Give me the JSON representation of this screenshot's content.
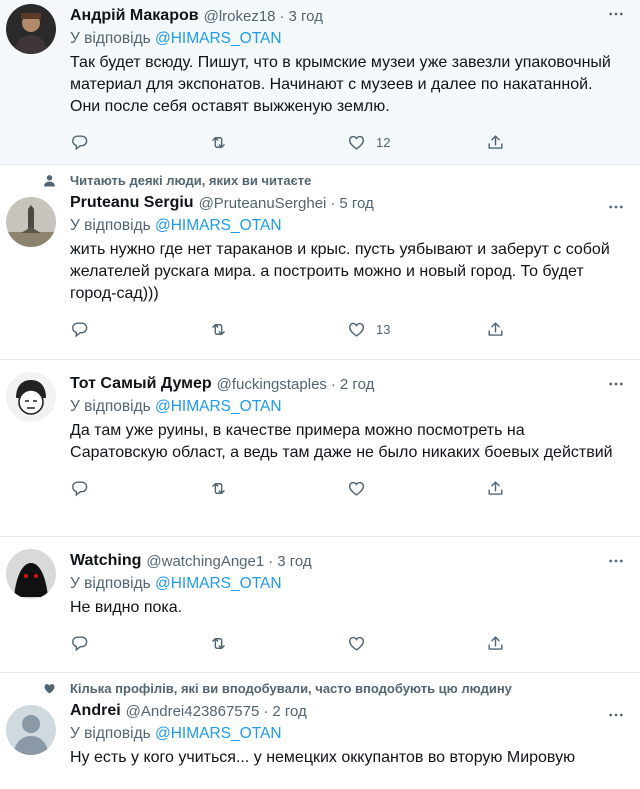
{
  "reply_prefix": "У відповідь",
  "tweets": [
    {
      "name": "Андрій Макаров",
      "handle": "@lrokez18",
      "time": "3 год",
      "mention": "@HIMARS_OTAN",
      "text": "Так будет всюду. Пишут, что в крымские музеи уже завезли упаковочный материал для экспонатов. Начинают с музеев и далее по накатанной. Они после себя оставят выжженую землю.",
      "likes": "12",
      "context": ""
    },
    {
      "name": "Pruteanu Sergiu",
      "handle": "@PruteanuSerghei",
      "time": "5 год",
      "mention": "@HIMARS_OTAN",
      "text": "жить нужно где нет тараканов и крыс. пусть уябывают и заберут с собой желателей рускага мира. а построить можно и новый город. То будет город-сад)))",
      "likes": "13",
      "context": "Читають деякі люди, яких ви читаєте"
    },
    {
      "name": "Тот Самый Думер",
      "handle": "@fuckingstaples",
      "time": "2 год",
      "mention": "@HIMARS_OTAN",
      "text": "Да там уже руины, в качестве примера можно посмотреть на Саратовскую област, а ведь там даже не было никаких боевых действий",
      "likes": "",
      "context": ""
    },
    {
      "name": "Watching",
      "handle": "@watchingAnge1",
      "time": "3 год",
      "mention": "@HIMARS_OTAN",
      "text": "Не видно пока.",
      "likes": "",
      "context": ""
    },
    {
      "name": "Andrei",
      "handle": "@Andrei423867575",
      "time": "2 год",
      "mention": "@HIMARS_OTAN",
      "text": "Ну есть у кого учиться... у немецких оккупантов во вторую Мировую",
      "likes": "",
      "context": "Кілька профілів, які ви вподобували, часто вподобують цю людину"
    }
  ],
  "icons": {
    "context_1": "person-icon",
    "context_4": "heart-filled-icon",
    "reply": "reply-icon",
    "retweet": "retweet-icon",
    "like": "heart-icon",
    "share": "share-icon",
    "more": "more-icon"
  },
  "colors": {
    "text": "#0f1419",
    "secondary": "#536471",
    "link": "#1d9bf0",
    "highlight_bg": "#f5f8fa"
  }
}
